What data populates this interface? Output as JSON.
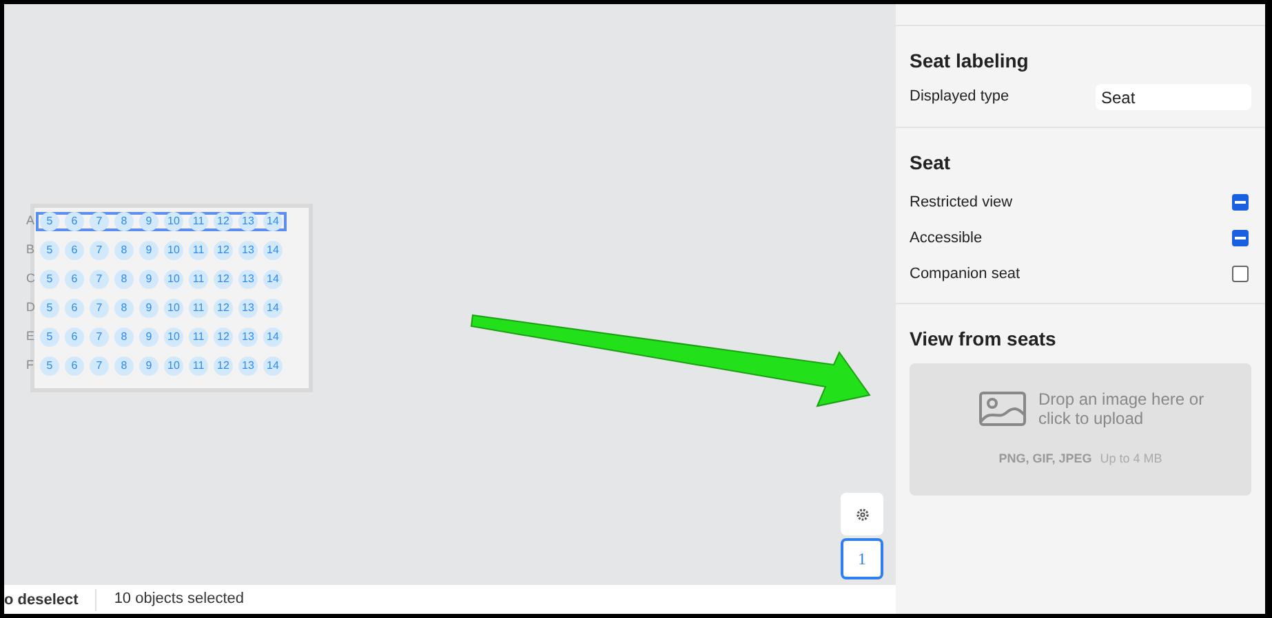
{
  "seat_map": {
    "rows": [
      {
        "label": "A",
        "selected": true,
        "seats": [
          "5",
          "6",
          "7",
          "8",
          "9",
          "10",
          "11",
          "12",
          "13",
          "14"
        ]
      },
      {
        "label": "B",
        "selected": false,
        "seats": [
          "5",
          "6",
          "7",
          "8",
          "9",
          "10",
          "11",
          "12",
          "13",
          "14"
        ]
      },
      {
        "label": "C",
        "selected": false,
        "seats": [
          "5",
          "6",
          "7",
          "8",
          "9",
          "10",
          "11",
          "12",
          "13",
          "14"
        ]
      },
      {
        "label": "D",
        "selected": false,
        "seats": [
          "5",
          "6",
          "7",
          "8",
          "9",
          "10",
          "11",
          "12",
          "13",
          "14"
        ]
      },
      {
        "label": "E",
        "selected": false,
        "seats": [
          "5",
          "6",
          "7",
          "8",
          "9",
          "10",
          "11",
          "12",
          "13",
          "14"
        ]
      },
      {
        "label": "F",
        "selected": false,
        "seats": [
          "5",
          "6",
          "7",
          "8",
          "9",
          "10",
          "11",
          "12",
          "13",
          "14"
        ]
      }
    ]
  },
  "zoom_controls": {
    "pages": [
      {
        "label": "1",
        "selected": true
      }
    ]
  },
  "status_bar": {
    "hint": "o deselect",
    "selection": "10 objects selected"
  },
  "panel": {
    "seat_labeling": {
      "title": "Seat labeling",
      "label": "Displayed type",
      "value": "Seat"
    },
    "seat": {
      "title": "Seat",
      "options": [
        {
          "label": "Restricted view",
          "checked": true,
          "indeterminate": true
        },
        {
          "label": "Accessible",
          "checked": true,
          "indeterminate": true
        },
        {
          "label": "Companion seat",
          "checked": false,
          "indeterminate": false
        }
      ]
    },
    "view_from_seats": {
      "title": "View from seats",
      "drop_text": "Drop an image here or click to upload",
      "formats": "PNG, GIF, JPEG",
      "limit": "Up to 4 MB"
    }
  }
}
